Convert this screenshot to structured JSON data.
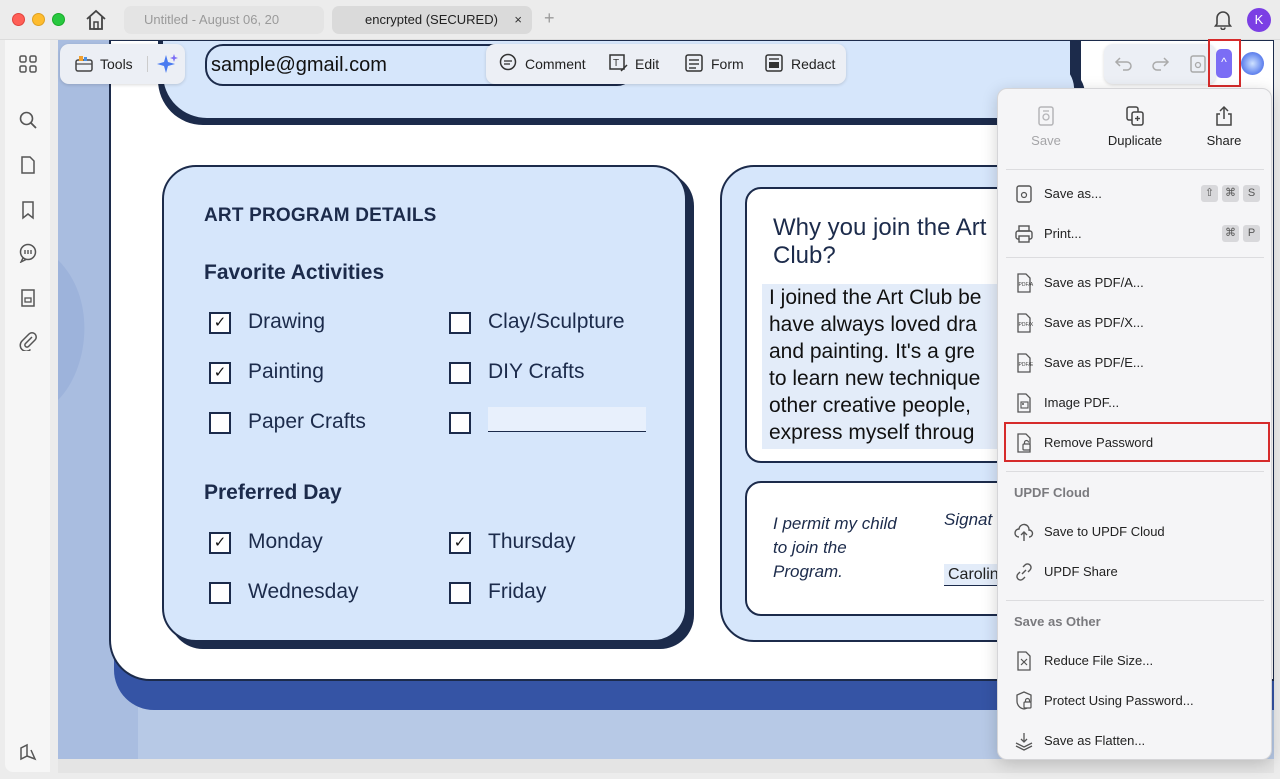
{
  "titlebar": {
    "tabs": [
      {
        "label": "Untitled - August 06, 20"
      },
      {
        "label": "encrypted (SECURED)",
        "close": "×"
      }
    ],
    "add_tab": "+",
    "avatar_letter": "K"
  },
  "toolbar": {
    "tools_label": "Tools",
    "modes": [
      "Comment",
      "Edit",
      "Form",
      "Redact"
    ],
    "expand_glyph": "^"
  },
  "document": {
    "email_value": "sample@gmail.com",
    "panel_title": "ART PROGRAM DETAILS",
    "favorite_heading": "Favorite Activities",
    "activities": [
      {
        "label": "Drawing",
        "checked": true
      },
      {
        "label": "Clay/Sculpture",
        "checked": false
      },
      {
        "label": "Painting",
        "checked": true
      },
      {
        "label": "DIY Crafts",
        "checked": false
      },
      {
        "label": "Paper Crafts",
        "checked": false
      },
      {
        "label": "",
        "checked": false
      }
    ],
    "day_heading": "Preferred Day",
    "days": [
      {
        "label": "Monday",
        "checked": true
      },
      {
        "label": "Thursday",
        "checked": true
      },
      {
        "label": "Wednesday",
        "checked": false
      },
      {
        "label": "Friday",
        "checked": false
      }
    ],
    "check_mark": "✓",
    "why_title": "Why you join the Art Club?",
    "why_answer_lines": [
      "I joined the Art Club be",
      "have always loved dra",
      "and painting. It's a gre",
      "to learn new technique",
      "other creative people,",
      "express myself throug"
    ],
    "permit_text": "I permit my child to join the Program.",
    "signature_label": "Signat",
    "signature_value": "Carolin"
  },
  "menu": {
    "top_actions": [
      {
        "label": "Save",
        "icon": "save-icon",
        "disabled": true
      },
      {
        "label": "Duplicate",
        "icon": "duplicate-icon",
        "disabled": false
      },
      {
        "label": "Share",
        "icon": "share-icon",
        "disabled": false
      }
    ],
    "items": [
      {
        "label": "Save as...",
        "icon": "save-as-icon",
        "shortcut": [
          "⇧",
          "⌘",
          "S"
        ]
      },
      {
        "label": "Print...",
        "icon": "print-icon",
        "shortcut": [
          "⌘",
          "P"
        ]
      },
      {
        "label": "Save as PDF/A...",
        "icon": "pdf-a-icon"
      },
      {
        "label": "Save as PDF/X...",
        "icon": "pdf-x-icon"
      },
      {
        "label": "Save as PDF/E...",
        "icon": "pdf-e-icon"
      },
      {
        "label": "Image PDF...",
        "icon": "image-pdf-icon"
      },
      {
        "label": "Remove Password",
        "icon": "remove-password-icon",
        "highlighted": true
      }
    ],
    "cloud_heading": "UPDF Cloud",
    "cloud_items": [
      {
        "label": "Save to UPDF Cloud",
        "icon": "cloud-upload-icon"
      },
      {
        "label": "UPDF Share",
        "icon": "link-icon"
      }
    ],
    "other_heading": "Save as Other",
    "other_items": [
      {
        "label": "Reduce File Size...",
        "icon": "reduce-size-icon"
      },
      {
        "label": "Protect Using Password...",
        "icon": "shield-lock-icon"
      },
      {
        "label": "Save as Flatten...",
        "icon": "flatten-icon"
      }
    ]
  },
  "colors": {
    "accent": "#7b6df5",
    "highlight_border": "#d62b2b",
    "page_panel": "#d6e6fb",
    "ink": "#1c2b4b"
  }
}
